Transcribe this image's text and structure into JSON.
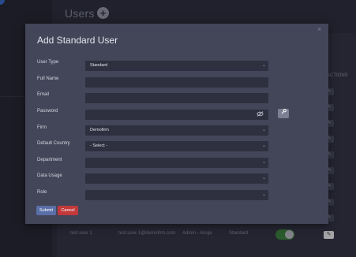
{
  "page": {
    "title": "Users",
    "actions_header": "ACTIONS",
    "row": {
      "name": "test user 1",
      "email": "test.user-1@demofirm.com",
      "role": "Admin - Anuja",
      "type": "Standard",
      "status_toggle": "on"
    }
  },
  "modal": {
    "title": "Add Standard User",
    "close_label": "×",
    "fields": {
      "user_type": {
        "label": "User Type",
        "value": "Standard"
      },
      "full_name": {
        "label": "Full Name",
        "value": ""
      },
      "email": {
        "label": "Email",
        "value": ""
      },
      "password": {
        "label": "Password",
        "value": ""
      },
      "firm": {
        "label": "Firm",
        "value": "Demofirm"
      },
      "default_country": {
        "label": "Default Country",
        "value": "- Select -"
      },
      "department": {
        "label": "Department",
        "value": ""
      },
      "data_usage": {
        "label": "Data Usage",
        "value": ""
      },
      "role": {
        "label": "Role",
        "value": ""
      }
    },
    "buttons": {
      "submit": "Submit",
      "cancel": "Cancel"
    }
  },
  "icons": {
    "chevron": "chevron-down-icon",
    "eye": "eye-slash-icon",
    "key": "wrench-icon",
    "edit": "pencil-icon",
    "add": "plus-icon"
  },
  "colors": {
    "submit": "#5a6fa8",
    "cancel": "#c2393b",
    "toggle_on": "#3d8a3a"
  }
}
